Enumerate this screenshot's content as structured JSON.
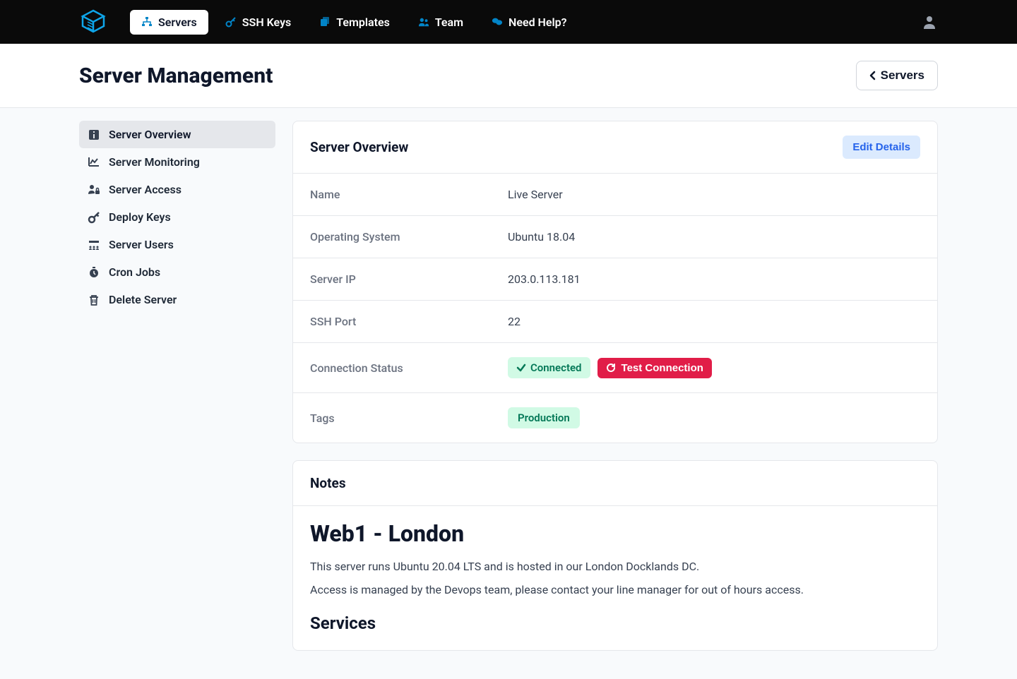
{
  "nav": {
    "items": [
      {
        "label": "Servers",
        "icon": "sitemap",
        "active": true
      },
      {
        "label": "SSH Keys",
        "icon": "key",
        "active": false
      },
      {
        "label": "Templates",
        "icon": "templates",
        "active": false
      },
      {
        "label": "Team",
        "icon": "team",
        "active": false
      },
      {
        "label": "Need Help?",
        "icon": "help",
        "active": false
      }
    ]
  },
  "header": {
    "page_title": "Server Management",
    "back_button": "Servers"
  },
  "sidebar": {
    "items": [
      {
        "label": "Server Overview",
        "icon": "info",
        "active": true
      },
      {
        "label": "Server Monitoring",
        "icon": "chart",
        "active": false
      },
      {
        "label": "Server Access",
        "icon": "lock-user",
        "active": false
      },
      {
        "label": "Deploy Keys",
        "icon": "key",
        "active": false
      },
      {
        "label": "Server Users",
        "icon": "users-grid",
        "active": false
      },
      {
        "label": "Cron Jobs",
        "icon": "stopwatch",
        "active": false
      },
      {
        "label": "Delete Server",
        "icon": "trash",
        "active": false
      }
    ]
  },
  "overview": {
    "title": "Server Overview",
    "edit_button": "Edit Details",
    "rows": {
      "name_label": "Name",
      "name_value": "Live Server",
      "os_label": "Operating System",
      "os_value": "Ubuntu 18.04",
      "ip_label": "Server IP",
      "ip_value": "203.0.113.181",
      "ssh_label": "SSH Port",
      "ssh_value": "22",
      "conn_label": "Connection Status",
      "conn_value": "Connected",
      "test_button": "Test Connection",
      "tags_label": "Tags",
      "tags": [
        "Production"
      ]
    }
  },
  "notes": {
    "title": "Notes",
    "heading": "Web1 - London",
    "p1": "This server runs Ubuntu 20.04 LTS and is hosted in our London Docklands DC.",
    "p2": "Access is managed by the Devops team, please contact your line manager for out of hours access.",
    "subheading": "Services"
  }
}
